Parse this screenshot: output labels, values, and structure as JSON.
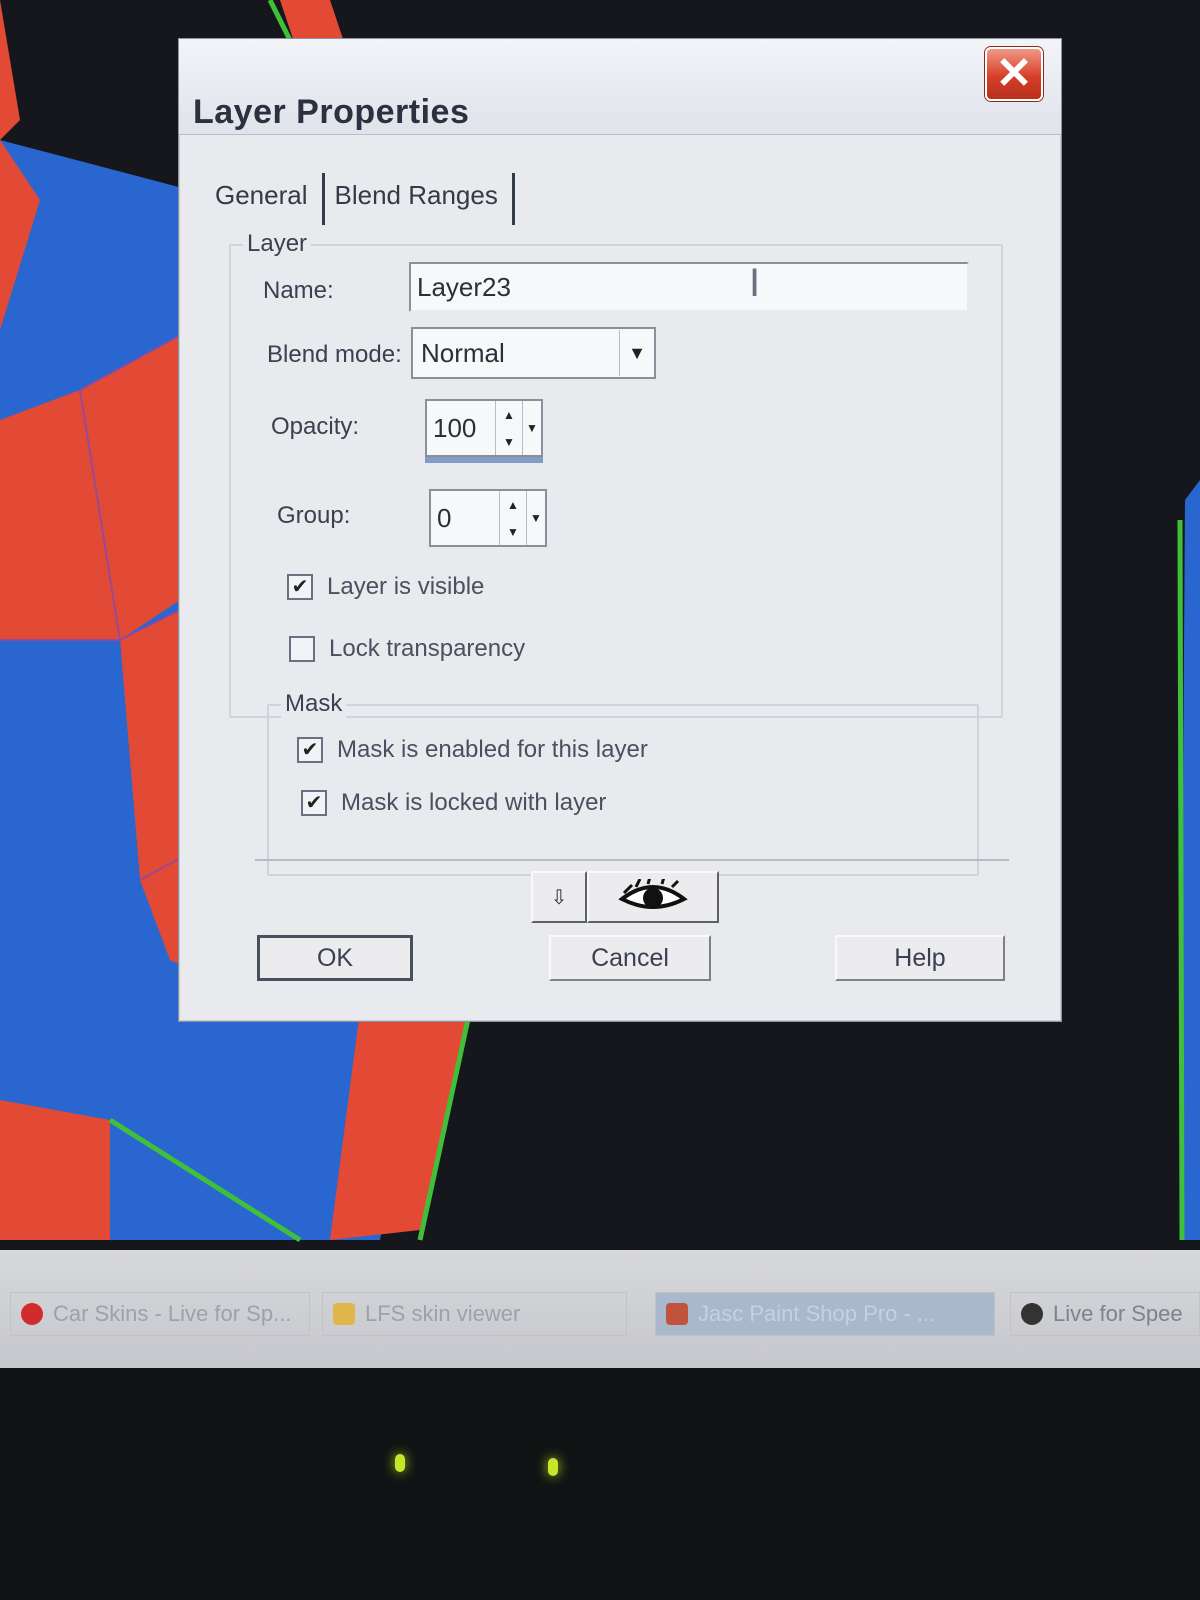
{
  "dialog": {
    "title": "Layer Properties",
    "close_symbol": "✕",
    "tabs": [
      {
        "label": "General"
      },
      {
        "label": "Blend Ranges"
      }
    ],
    "layer_group": {
      "label": "Layer",
      "name_label": "Name:",
      "name_value": "Layer23",
      "blend_mode_label": "Blend mode:",
      "blend_mode_value": "Normal",
      "opacity_label": "Opacity:",
      "opacity_value": "100",
      "group_label": "Group:",
      "group_value": "0",
      "layer_visible_label": "Layer is visible",
      "layer_visible_checked": true,
      "lock_transparency_label": "Lock transparency",
      "lock_transparency_checked": false
    },
    "mask_group": {
      "label": "Mask",
      "mask_enabled_label": "Mask is enabled for this layer",
      "mask_enabled_checked": true,
      "mask_locked_label": "Mask is locked with layer",
      "mask_locked_checked": true
    },
    "buttons": {
      "ok": "OK",
      "cancel": "Cancel",
      "help": "Help"
    },
    "icons": {
      "arrow_icon": "arrow-down-icon",
      "eye_icon": "eye-icon"
    }
  },
  "taskbar": {
    "items": [
      {
        "label": "Car Skins - Live for Sp...",
        "icon": "opera-icon"
      },
      {
        "label": "LFS skin viewer",
        "icon": "folder-icon"
      },
      {
        "label": "Jasc Paint Shop Pro - ...",
        "icon": "paintshop-icon",
        "active": true
      },
      {
        "label": "Live for Spee",
        "icon": "lfs-icon"
      }
    ]
  },
  "colors": {
    "accent_blue": "#2b6fd6",
    "accent_red": "#e0452f",
    "accent_green": "#3fbf3a",
    "dialog_bg": "#e9eaee",
    "close_red": "#d5402a"
  }
}
